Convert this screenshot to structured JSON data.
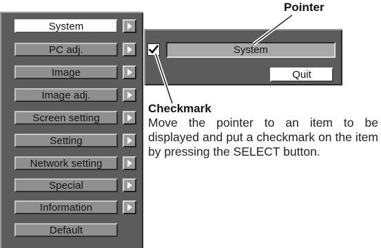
{
  "menu": {
    "items": [
      {
        "label": "System",
        "selected": true,
        "has_arrow": true
      },
      {
        "label": "PC adj.",
        "selected": false,
        "has_arrow": true
      },
      {
        "label": "Image",
        "selected": false,
        "has_arrow": true
      },
      {
        "label": "Image adj.",
        "selected": false,
        "has_arrow": true
      },
      {
        "label": "Screen setting",
        "selected": false,
        "has_arrow": true
      },
      {
        "label": "Setting",
        "selected": false,
        "has_arrow": true
      },
      {
        "label": "Network setting",
        "selected": false,
        "has_arrow": true
      },
      {
        "label": "Special",
        "selected": false,
        "has_arrow": true
      },
      {
        "label": "Information",
        "selected": false,
        "has_arrow": true
      },
      {
        "label": "Default",
        "selected": false,
        "has_arrow": false
      }
    ]
  },
  "submenu": {
    "checked": true,
    "field_value": "System",
    "quit_label": "Quit"
  },
  "annotations": {
    "pointer_label": "Pointer",
    "checkmark_title": "Checkmark",
    "checkmark_description": "Move the pointer to an item to be displayed and put a checkmark on the item by pressing the SELECT button."
  },
  "colors": {
    "panel": "#5c5c5c",
    "item": "#8f8f8f",
    "selected_item": "#ffffff",
    "field": "#a9a9a9"
  }
}
